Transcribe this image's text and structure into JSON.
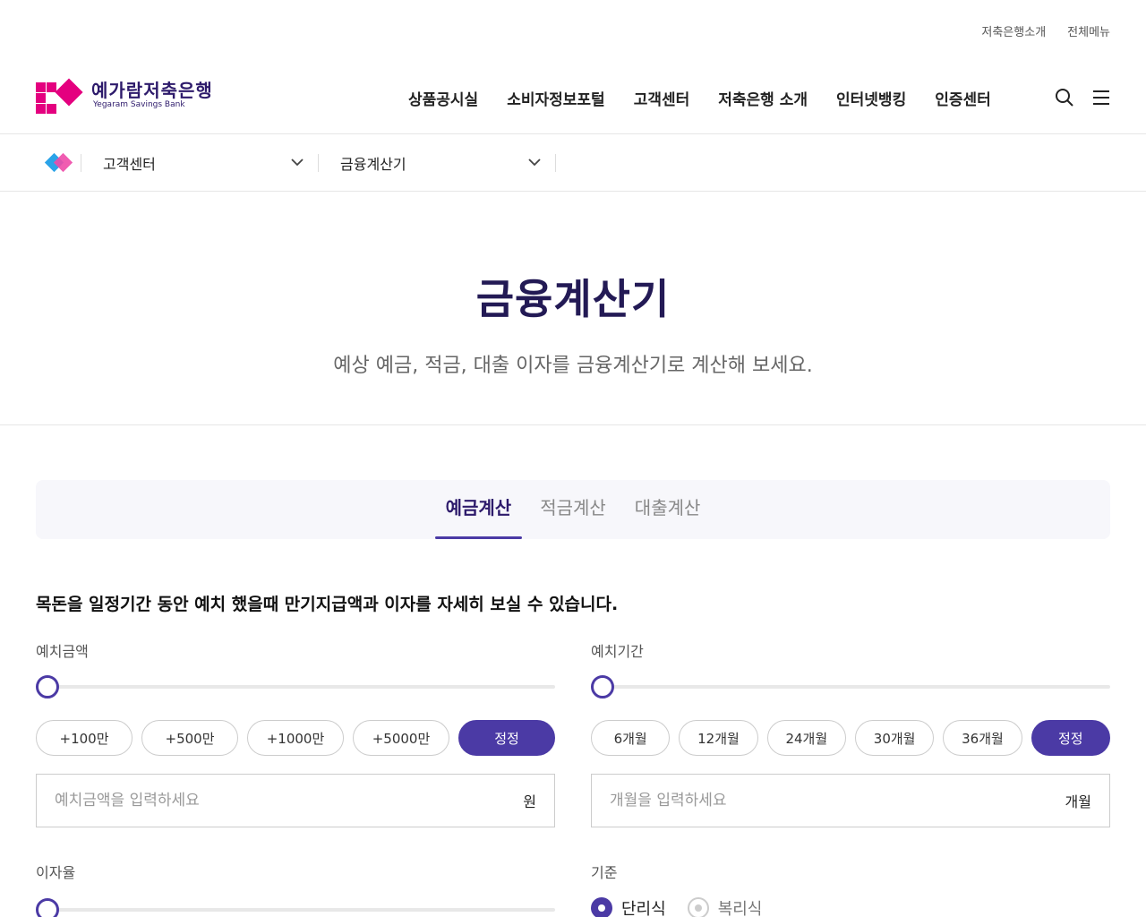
{
  "util_links": [
    "저축은행소개",
    "전체메뉴"
  ],
  "logo": {
    "ko": "예가람저축은행",
    "en": "Yegaram Savings Bank"
  },
  "gnb": [
    "상품공시실",
    "소비자정보포털",
    "고객센터",
    "저축은행 소개",
    "인터넷뱅킹",
    "인증센터"
  ],
  "breadcrumb": {
    "level1": "고객센터",
    "level2": "금융계산기"
  },
  "page": {
    "title": "금융계산기",
    "subtitle": "예상 예금, 적금, 대출 이자를 금융계산기로 계산해 보세요."
  },
  "tabs": [
    "예금계산",
    "적금계산",
    "대출계산"
  ],
  "active_tab": "예금계산",
  "description": "목돈을 일정기간 동안 예치 했을때 만기지급액과 이자를 자세히 보실 수 있습니다.",
  "deposit_amount": {
    "label": "예치금액",
    "chips": [
      "+100만",
      "+500만",
      "+1000만",
      "+5000만"
    ],
    "reset": "정정",
    "placeholder": "예치금액을 입력하세요",
    "unit": "원"
  },
  "deposit_period": {
    "label": "예치기간",
    "chips": [
      "6개월",
      "12개월",
      "24개월",
      "30개월",
      "36개월"
    ],
    "reset": "정정",
    "placeholder": "개월을 입력하세요",
    "unit": "개월"
  },
  "interest_rate": {
    "label": "이자율"
  },
  "basis": {
    "label": "기준",
    "options": [
      "단리식",
      "복리식"
    ],
    "selected": "단리식"
  },
  "colors": {
    "accent": "#4b3aa5",
    "brand_pink": "#e4007f",
    "title": "#231a55"
  }
}
